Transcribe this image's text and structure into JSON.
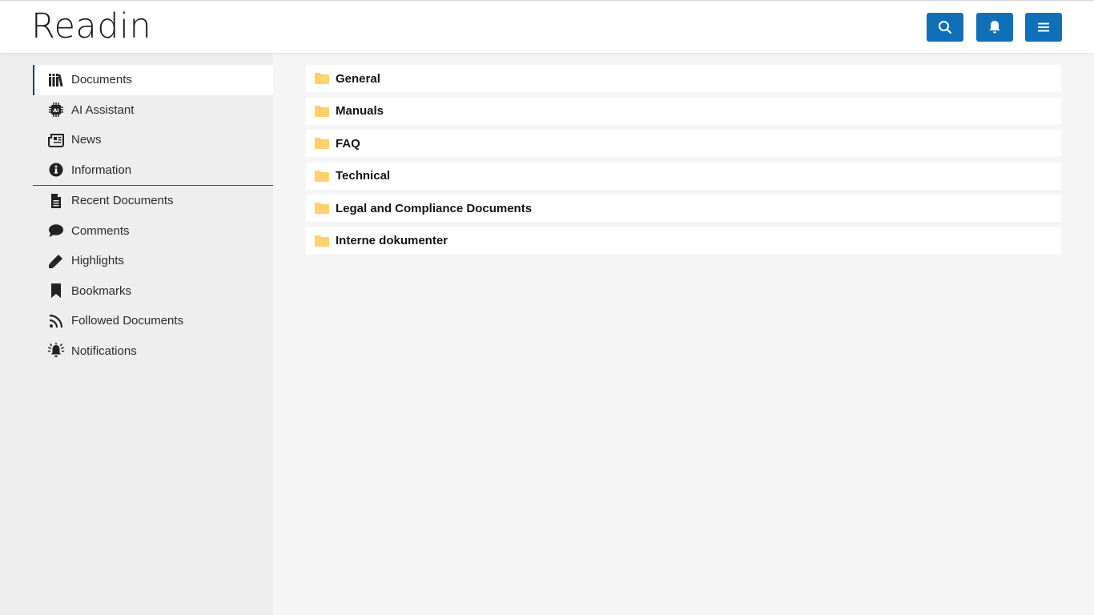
{
  "app": {
    "logo_text": "Readin"
  },
  "header": {
    "buttons": [
      {
        "icon": "search-icon"
      },
      {
        "icon": "bell-icon"
      },
      {
        "icon": "menu-icon"
      }
    ],
    "button_color": "#0f70b7"
  },
  "sidebar": {
    "primary_items": [
      {
        "label": "Documents",
        "icon": "library-icon",
        "active": true
      },
      {
        "label": "AI Assistant",
        "icon": "ai-chip-icon"
      },
      {
        "label": "News",
        "icon": "newspaper-icon"
      },
      {
        "label": "Information",
        "icon": "info-icon"
      }
    ],
    "secondary_items": [
      {
        "label": "Recent Documents",
        "icon": "file-icon"
      },
      {
        "label": "Comments",
        "icon": "comment-icon"
      },
      {
        "label": "Highlights",
        "icon": "highlighter-icon"
      },
      {
        "label": "Bookmarks",
        "icon": "bookmark-icon"
      },
      {
        "label": "Followed Documents",
        "icon": "rss-icon"
      },
      {
        "label": "Notifications",
        "icon": "alarm-bell-icon"
      }
    ]
  },
  "folders": [
    {
      "label": "General"
    },
    {
      "label": "Manuals"
    },
    {
      "label": "FAQ"
    },
    {
      "label": "Technical"
    },
    {
      "label": "Legal and Compliance Documents"
    },
    {
      "label": "Interne dokumenter"
    }
  ],
  "colors": {
    "accent": "#0f70b7",
    "folder": "#ffd36b",
    "active_border": "#1e3a6e"
  }
}
